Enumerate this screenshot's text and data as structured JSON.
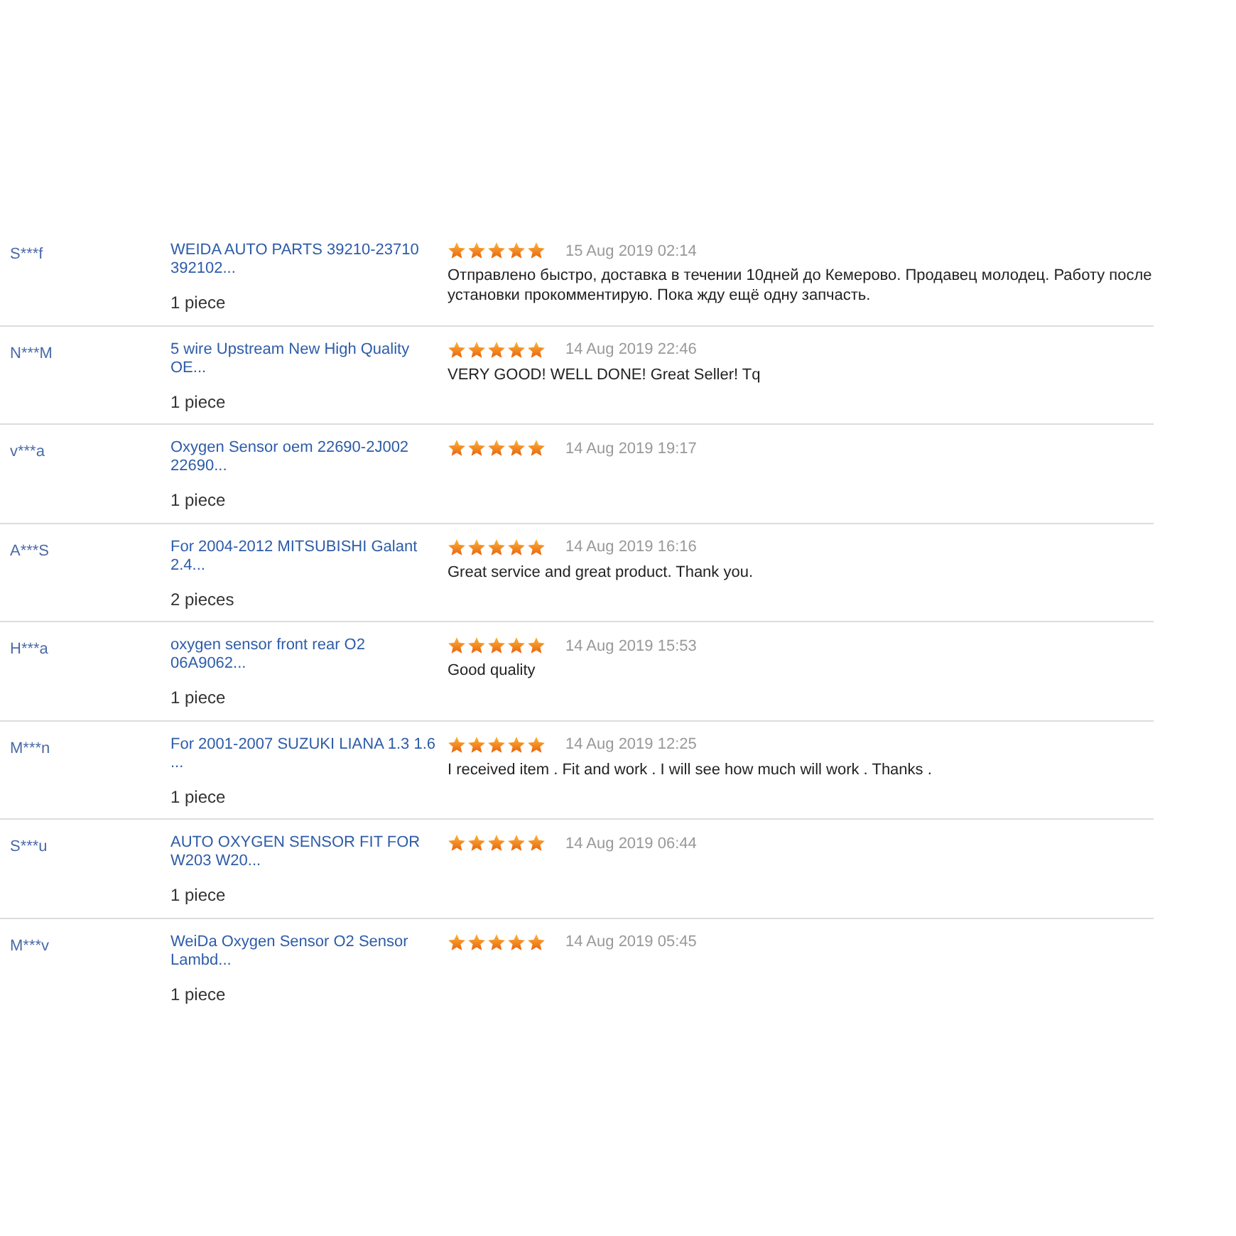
{
  "reviews": [
    {
      "user": "S***f",
      "product": "WEIDA AUTO PARTS 39210-23710 392102...",
      "quantity": "1 piece",
      "stars": 5,
      "date": "15 Aug 2019 02:14",
      "comment": "Отправлено быстро, доставка в течении 10дней до Кемерово. Продавец молодец. Работу после установки прокомментирую. Пока жду ещё одну запчасть."
    },
    {
      "user": "N***M",
      "product": "5 wire Upstream New High Quality OE...",
      "quantity": "1 piece",
      "stars": 5,
      "date": "14 Aug 2019 22:46",
      "comment": "VERY GOOD! WELL DONE! Great Seller! Tq"
    },
    {
      "user": "v***a",
      "product": "Oxygen Sensor oem 22690-2J002 22690...",
      "quantity": "1 piece",
      "stars": 5,
      "date": "14 Aug 2019 19:17"
    },
    {
      "user": "A***S",
      "product": "For 2004-2012 MITSUBISHI Galant 2.4...",
      "quantity": "2 pieces",
      "stars": 5,
      "date": "14 Aug 2019 16:16",
      "comment": "Great service and great product. Thank you."
    },
    {
      "user": "H***a",
      "product": "oxygen sensor front rear O2 06A9062...",
      "quantity": "1 piece",
      "stars": 5,
      "date": "14 Aug 2019 15:53",
      "comment": "Good quality"
    },
    {
      "user": "M***n",
      "product": "For 2001-2007 SUZUKI LIANA 1.3 1.6 ...",
      "quantity": "1 piece",
      "stars": 5,
      "date": "14 Aug 2019 12:25",
      "comment": "I received item . Fit and work . I will see how much will work . Thanks ."
    },
    {
      "user": "S***u",
      "product": "AUTO OXYGEN SENSOR FIT FOR W203 W20...",
      "quantity": "1 piece",
      "stars": 5,
      "date": "14 Aug 2019 06:44"
    },
    {
      "user": "M***v",
      "product": "WeiDa Oxygen Sensor O2 Sensor Lambd...",
      "quantity": "1 piece",
      "stars": 5,
      "date": "14 Aug 2019 05:45"
    }
  ]
}
